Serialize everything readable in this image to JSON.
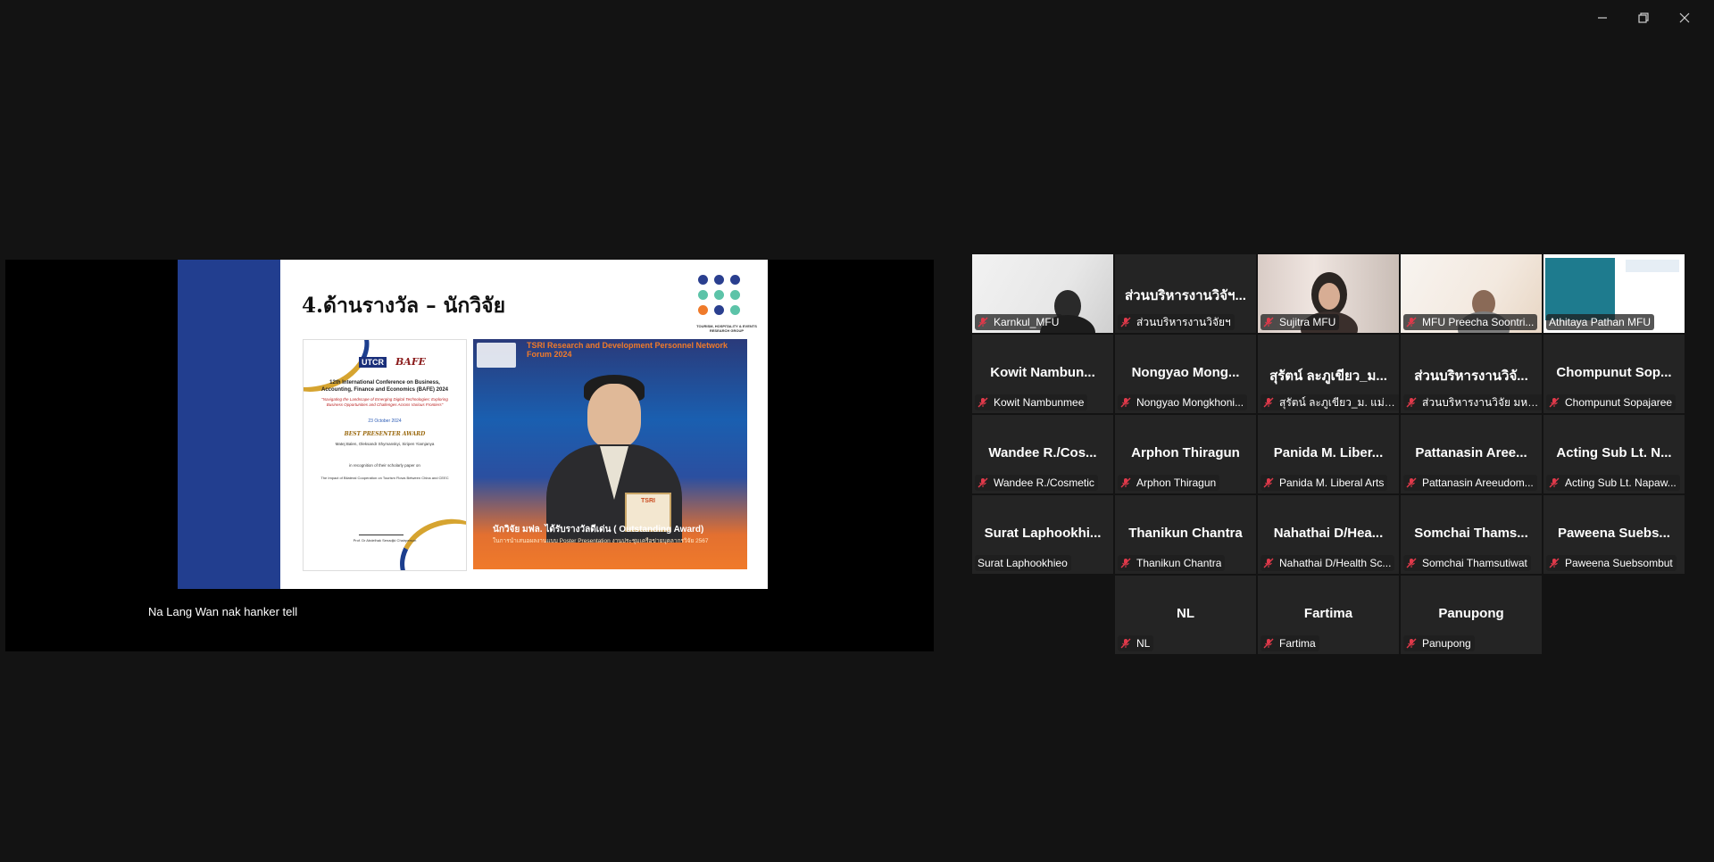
{
  "window_controls": {
    "minimize": "minimize",
    "restore": "restore",
    "close": "close"
  },
  "share": {
    "slide_title": "4.ด้านรางวัล – นักวิจัย",
    "dots_caption": "TOURISM, HOSPITALITY & EVENTS RESEARCH GROUP",
    "certificate": {
      "org1": "UTCR",
      "org2": "BAFE",
      "conference": "12th International Conference on Business, Accounting, Finance and Economics (BAFE) 2024",
      "theme": "\"Navigating the Landscape of Emerging Digital Technologies: Exploring Business Opportunities and Challenges Across Various Frontiers\"",
      "date": "23 October 2024",
      "award": "BEST PRESENTER AWARD",
      "authors": "Matej Balen, Oleksandr Shymanskyi, Siripen Yiamjanya",
      "recognition": "in recognition of their scholarly paper on",
      "paper": "The Impact of Bilateral Cooperation on Tourism Flows Between China and CEEC",
      "signer": "Prof. Dr Abdelhak Senadjki Chairperson"
    },
    "photo": {
      "header": "TSRI Research and Development Personnel Network Forum 2024",
      "board": "TSRI",
      "caption": "นักวิจัย มฟล. ได้รับรางวัลดีเด่น ( Outstanding Award)",
      "caption2": "ในการนำเสนอผลงานแบบ Poster Presentation งานประชุมเครือข่ายบุคลากรวิจัย 2567"
    },
    "subtitle": "Na Lang Wan nak hanker tell"
  },
  "participants": [
    {
      "big": "",
      "label": "Karnkul_MFU",
      "muted": true,
      "video": "v1"
    },
    {
      "big": "ส่วนบริหารงานวิจัฯ...",
      "label": "ส่วนบริหารงานวิจัยฯ",
      "muted": true,
      "video": ""
    },
    {
      "big": "",
      "label": "Sujitra MFU",
      "muted": true,
      "video": "v2"
    },
    {
      "big": "",
      "label": "MFU Preecha Soontri...",
      "muted": true,
      "video": "v3"
    },
    {
      "big": "",
      "label": "Athitaya Pathan MFU",
      "muted": false,
      "video": "v4",
      "active": true
    },
    {
      "big": "Kowit Nambun...",
      "label": "Kowit Nambunmee",
      "muted": true
    },
    {
      "big": "Nongyao Mong...",
      "label": "Nongyao Mongkhoni...",
      "muted": true
    },
    {
      "big": "สุรัตน์ ละภูเขียว_ม...",
      "label": "สุรัตน์ ละภูเขียว_ม. แม่ฟ้า...",
      "muted": true
    },
    {
      "big": "ส่วนบริหารงานวิจั...",
      "label": "ส่วนบริหารงานวิจัย มหาวิ...",
      "muted": true
    },
    {
      "big": "Chompunut Sop...",
      "label": "Chompunut Sopajaree",
      "muted": true
    },
    {
      "big": "Wandee R./Cos...",
      "label": "Wandee R./Cosmetic",
      "muted": true
    },
    {
      "big": "Arphon Thiragun",
      "label": "Arphon Thiragun",
      "muted": true
    },
    {
      "big": "Panida M. Liber...",
      "label": "Panida M. Liberal Arts",
      "muted": true
    },
    {
      "big": "Pattanasin Aree...",
      "label": "Pattanasin Areeudom...",
      "muted": true
    },
    {
      "big": "Acting Sub Lt. N...",
      "label": "Acting Sub Lt. Napaw...",
      "muted": true
    },
    {
      "big": "Surat Laphookhi...",
      "label": "Surat Laphookhieo",
      "muted": false
    },
    {
      "big": "Thanikun Chantra",
      "label": "Thanikun Chantra",
      "muted": true
    },
    {
      "big": "Nahathai D/Hea...",
      "label": "Nahathai D/Health Sc...",
      "muted": true
    },
    {
      "big": "Somchai Thams...",
      "label": "Somchai Thamsutiwat",
      "muted": true
    },
    {
      "big": "Paweena Suebs...",
      "label": "Paweena Suebsombut",
      "muted": true
    },
    {
      "big": "NL",
      "label": "NL",
      "muted": true
    },
    {
      "big": "Fartima",
      "label": "Fartima",
      "muted": true
    },
    {
      "big": "Panupong",
      "label": "Panupong",
      "muted": true
    }
  ],
  "colors": {
    "muted_icon": "#e0394a",
    "active_border": "#26c281",
    "slide_blue": "#223e8f"
  }
}
